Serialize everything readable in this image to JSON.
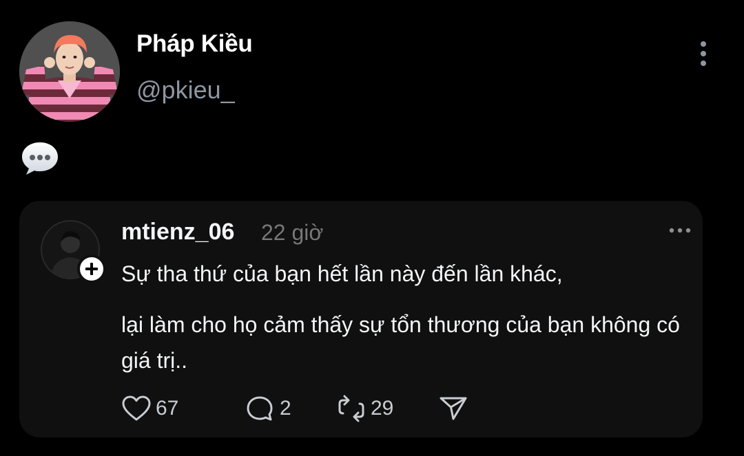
{
  "profile": {
    "display_name": "Pháp Kiều",
    "handle": "@pkieu_",
    "avatar": "profile-photo",
    "menu_icon": "vertical-ellipsis-icon"
  },
  "reaction": {
    "icon": "speech-bubble-emoji"
  },
  "post": {
    "author": "mtienz_06",
    "time": "22 giờ",
    "paragraph_1": "Sự tha thứ của bạn hết lần này đến lần khác,",
    "paragraph_2": "lại làm cho họ cảm thấy sự tổn thương của bạn không có giá trị..",
    "actions": {
      "likes": "67",
      "replies": "2",
      "reposts": "29"
    },
    "icons": {
      "like": "heart-icon",
      "reply": "comment-bubble-icon",
      "repost": "repost-icon",
      "share": "send-icon",
      "follow": "plus-icon",
      "more": "horizontal-ellipsis-icon"
    }
  }
}
